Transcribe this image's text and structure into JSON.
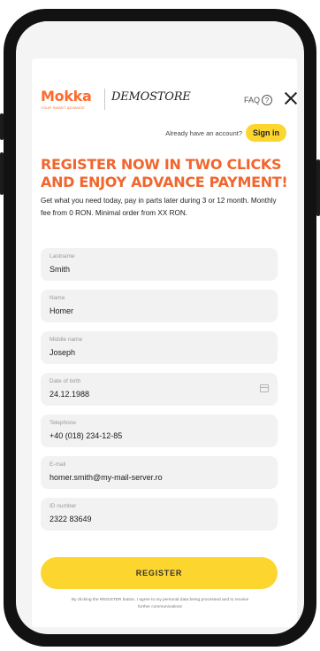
{
  "header": {
    "logo_text": "Mokka",
    "logo_tagline": "your smart advance",
    "partner_logo": "DEMOSTORE",
    "faq_label": "FAQ",
    "faq_icon": "?"
  },
  "account": {
    "prompt": "Already have an account?",
    "signin_label": "Sign in"
  },
  "headline": "Register now in two clicks and enjoy advance payment!",
  "description": "Get what you need today, pay in parts later during 3 or 12 month. Monthly fee from 0 RON. Minimal order from XX RON.",
  "form": {
    "lastname": {
      "label": "Lastname",
      "value": "Smith"
    },
    "name": {
      "label": "Name",
      "value": "Homer"
    },
    "middle_name": {
      "label": "Middle name",
      "value": "Joseph"
    },
    "birth_date": {
      "label": "Date of birth",
      "value": "24.12.1988"
    },
    "telephone": {
      "label": "Telephone",
      "value": "+40 (018) 234-12-85"
    },
    "email": {
      "label": "E-mail",
      "value": "homer.smith@my-mail-server.ro"
    },
    "id_number": {
      "label": "ID number",
      "value": "2322 83649"
    }
  },
  "register_label": "REGISTER",
  "consent_text": "By clicking the REGISTER button, I agree to my personal data being processed and to receive further communications",
  "colors": {
    "brand_orange": "#ff6a2c",
    "accent_yellow": "#fcd62f",
    "field_bg": "#f2f2f2"
  }
}
